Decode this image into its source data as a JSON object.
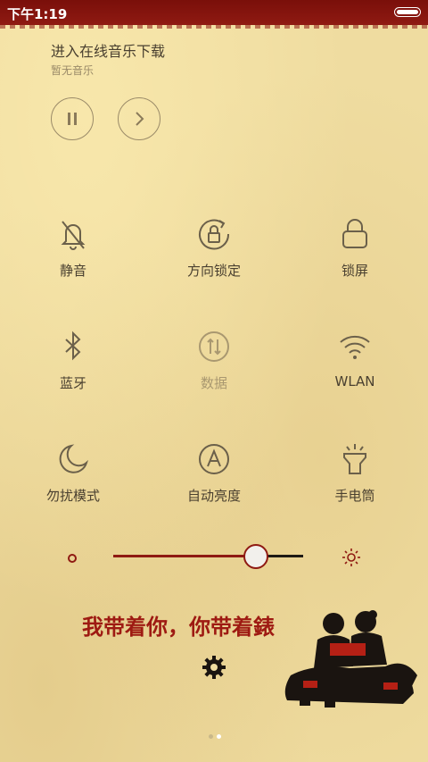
{
  "status_bar": {
    "time": "下午1:19"
  },
  "music": {
    "title": "进入在线音乐下载",
    "subtitle": "暂无音乐",
    "controls": [
      "pause-icon",
      "next-icon"
    ]
  },
  "tiles": [
    {
      "label": "静音",
      "icon": "mute-bell-icon"
    },
    {
      "label": "方向锁定",
      "icon": "rotation-lock-icon"
    },
    {
      "label": "锁屏",
      "icon": "lock-icon"
    },
    {
      "label": "蓝牙",
      "icon": "bluetooth-icon"
    },
    {
      "label": "数据",
      "icon": "data-icon",
      "enabled": false
    },
    {
      "label": "WLAN",
      "icon": "wifi-icon"
    },
    {
      "label": "勿扰模式",
      "icon": "moon-icon"
    },
    {
      "label": "自动亮度",
      "icon": "auto-brightness-icon"
    },
    {
      "label": "手电筒",
      "icon": "flashlight-icon"
    }
  ],
  "brightness": {
    "level": 0.75
  },
  "slogan": "我带着你，你带着錶",
  "page_indicator": {
    "pages": 2,
    "current": 2
  },
  "colors": {
    "accent": "#8f1a12",
    "background": "#efdca0",
    "icon": "#6b604a"
  }
}
